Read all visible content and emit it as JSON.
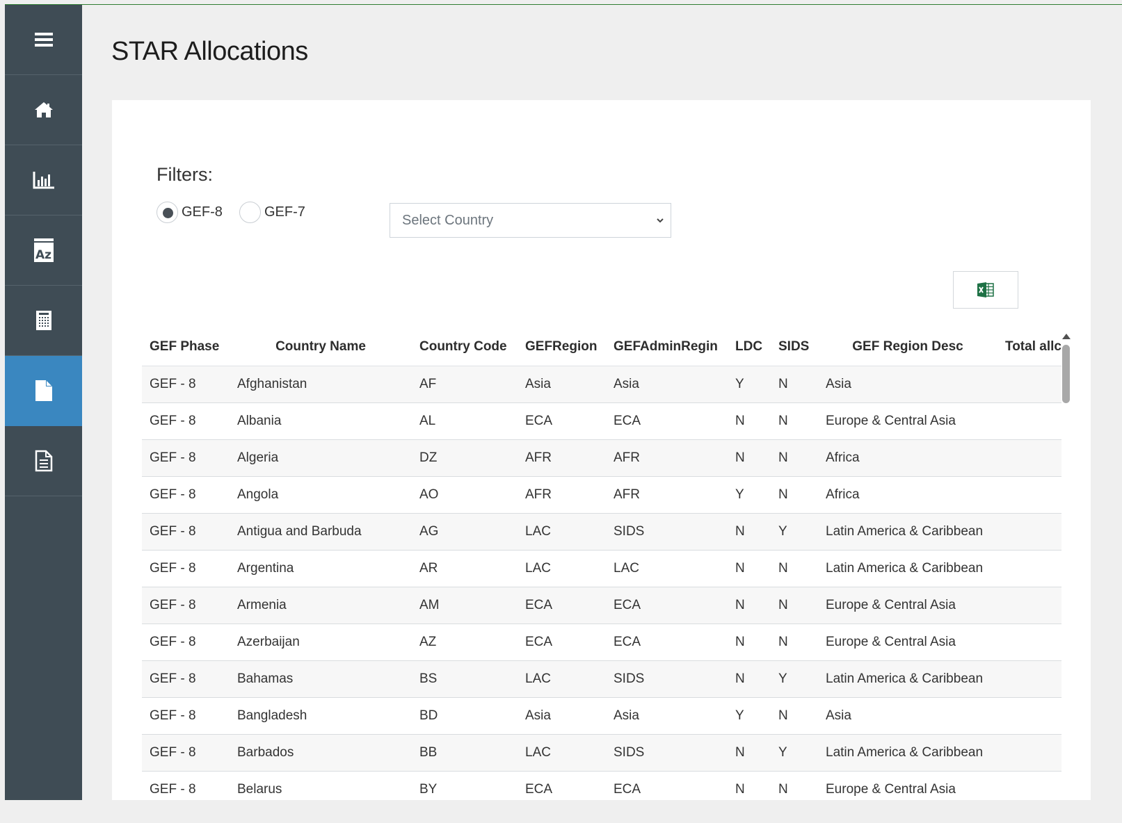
{
  "page": {
    "title": "STAR Allocations"
  },
  "sidebar": {
    "items": [
      {
        "icon": "menu-icon"
      },
      {
        "icon": "home-icon"
      },
      {
        "icon": "bar-chart-icon"
      },
      {
        "icon": "az-glossary-icon"
      },
      {
        "icon": "calculator-icon"
      },
      {
        "icon": "file-icon",
        "active": true
      },
      {
        "icon": "document-text-icon"
      }
    ],
    "colors": {
      "background": "#3f4c55",
      "active": "#3a87c0"
    }
  },
  "filters": {
    "label": "Filters:",
    "phase_options": [
      {
        "label": "GEF-8",
        "checked": true
      },
      {
        "label": "GEF-7",
        "checked": false
      }
    ],
    "country_select": {
      "placeholder": "Select Country"
    }
  },
  "export": {
    "icon": "excel-icon",
    "color": "#1e7145"
  },
  "table": {
    "columns": [
      "GEF Phase",
      "Country Name",
      "Country Code",
      "GEFRegion",
      "GEFAdminRegin",
      "LDC",
      "SIDS",
      "GEF Region Desc",
      "Total allc"
    ],
    "rows": [
      [
        "GEF - 8",
        "Afghanistan",
        "AF",
        "Asia",
        "Asia",
        "Y",
        "N",
        "Asia"
      ],
      [
        "GEF - 8",
        "Albania",
        "AL",
        "ECA",
        "ECA",
        "N",
        "N",
        "Europe & Central Asia"
      ],
      [
        "GEF - 8",
        "Algeria",
        "DZ",
        "AFR",
        "AFR",
        "N",
        "N",
        "Africa"
      ],
      [
        "GEF - 8",
        "Angola",
        "AO",
        "AFR",
        "AFR",
        "Y",
        "N",
        "Africa"
      ],
      [
        "GEF - 8",
        "Antigua and Barbuda",
        "AG",
        "LAC",
        "SIDS",
        "N",
        "Y",
        "Latin America & Caribbean"
      ],
      [
        "GEF - 8",
        "Argentina",
        "AR",
        "LAC",
        "LAC",
        "N",
        "N",
        "Latin America & Caribbean"
      ],
      [
        "GEF - 8",
        "Armenia",
        "AM",
        "ECA",
        "ECA",
        "N",
        "N",
        "Europe & Central Asia"
      ],
      [
        "GEF - 8",
        "Azerbaijan",
        "AZ",
        "ECA",
        "ECA",
        "N",
        "N",
        "Europe & Central Asia"
      ],
      [
        "GEF - 8",
        "Bahamas",
        "BS",
        "LAC",
        "SIDS",
        "N",
        "Y",
        "Latin America & Caribbean"
      ],
      [
        "GEF - 8",
        "Bangladesh",
        "BD",
        "Asia",
        "Asia",
        "Y",
        "N",
        "Asia"
      ],
      [
        "GEF - 8",
        "Barbados",
        "BB",
        "LAC",
        "SIDS",
        "N",
        "Y",
        "Latin America & Caribbean"
      ],
      [
        "GEF - 8",
        "Belarus",
        "BY",
        "ECA",
        "ECA",
        "N",
        "N",
        "Europe & Central Asia"
      ]
    ]
  }
}
